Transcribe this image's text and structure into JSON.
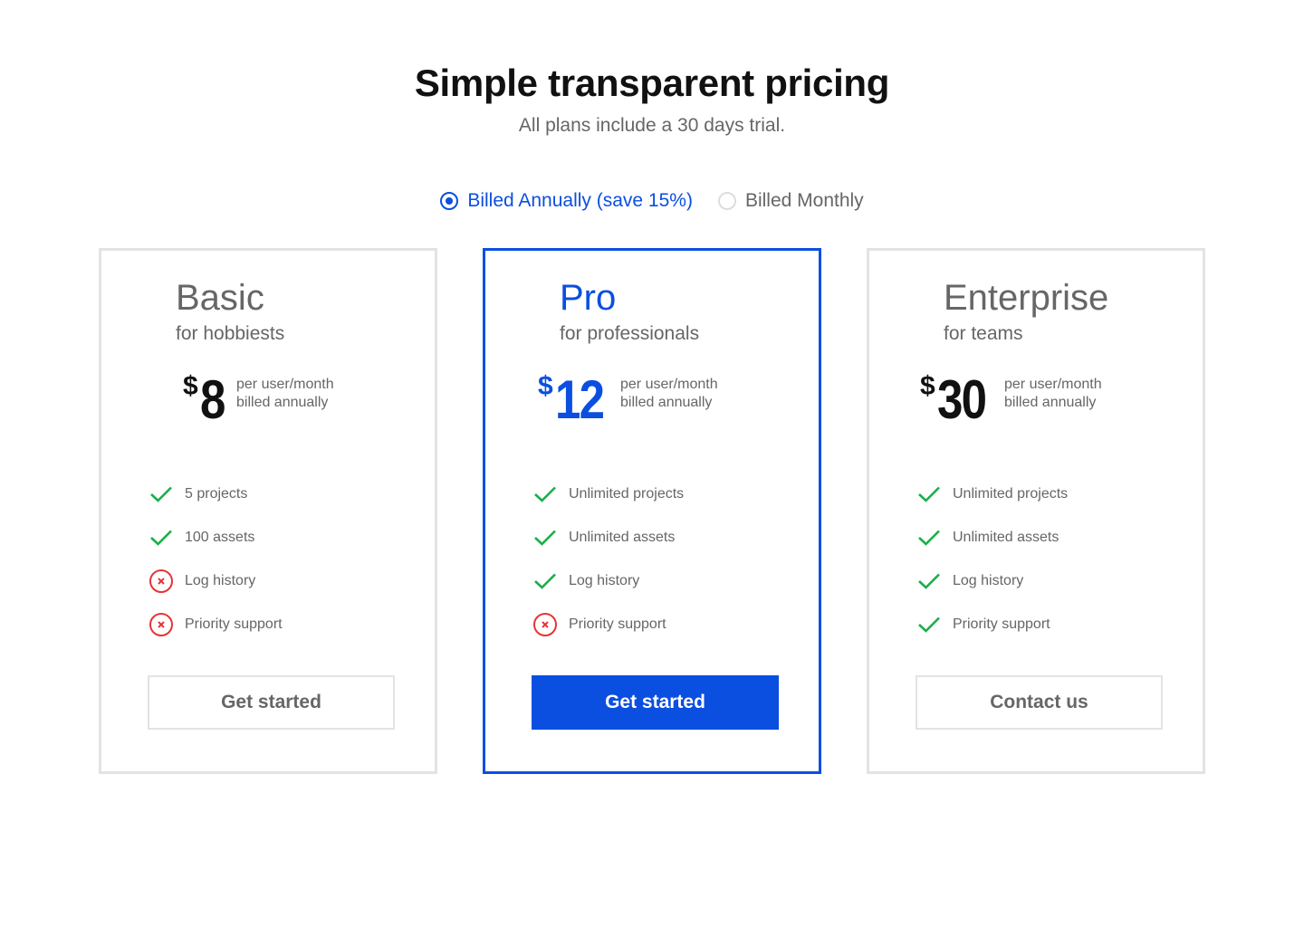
{
  "header": {
    "title": "Simple transparent pricing",
    "subtitle": "All plans include a 30 days trial."
  },
  "billing": {
    "options": [
      {
        "label": "Billed Annually (save 15%)",
        "selected": true
      },
      {
        "label": "Billed Monthly",
        "selected": false
      }
    ]
  },
  "colors": {
    "accent": "#0a4fe0",
    "check": "#1aae49",
    "cross": "#e53535",
    "muted_text": "#666666",
    "border": "#e3e3e3"
  },
  "plans": [
    {
      "name": "Basic",
      "tagline": "for hobbiests",
      "currency": "$",
      "price": "8",
      "price_note_1": "per user/month",
      "price_note_2": "billed annually",
      "features": [
        {
          "label": "5 projects",
          "included": true,
          "icon": "check-icon"
        },
        {
          "label": "100 assets",
          "included": true,
          "icon": "check-icon"
        },
        {
          "label": "Log history",
          "included": false,
          "icon": "cross-circle-icon"
        },
        {
          "label": "Priority support",
          "included": false,
          "icon": "cross-circle-icon"
        }
      ],
      "cta": "Get started"
    },
    {
      "name": "Pro",
      "tagline": "for professionals",
      "currency": "$",
      "price": "12",
      "price_note_1": "per user/month",
      "price_note_2": "billed annually",
      "features": [
        {
          "label": "Unlimited projects",
          "included": true,
          "icon": "check-icon"
        },
        {
          "label": "Unlimited assets",
          "included": true,
          "icon": "check-icon"
        },
        {
          "label": "Log history",
          "included": true,
          "icon": "check-icon"
        },
        {
          "label": "Priority support",
          "included": false,
          "icon": "cross-circle-icon"
        }
      ],
      "cta": "Get started"
    },
    {
      "name": "Enterprise",
      "tagline": "for teams",
      "currency": "$",
      "price": "30",
      "price_note_1": "per user/month",
      "price_note_2": "billed annually",
      "features": [
        {
          "label": "Unlimited projects",
          "included": true,
          "icon": "check-icon"
        },
        {
          "label": "Unlimited assets",
          "included": true,
          "icon": "check-icon"
        },
        {
          "label": "Log history",
          "included": true,
          "icon": "check-icon"
        },
        {
          "label": "Priority support",
          "included": true,
          "icon": "check-icon"
        }
      ],
      "cta": "Contact us"
    }
  ]
}
